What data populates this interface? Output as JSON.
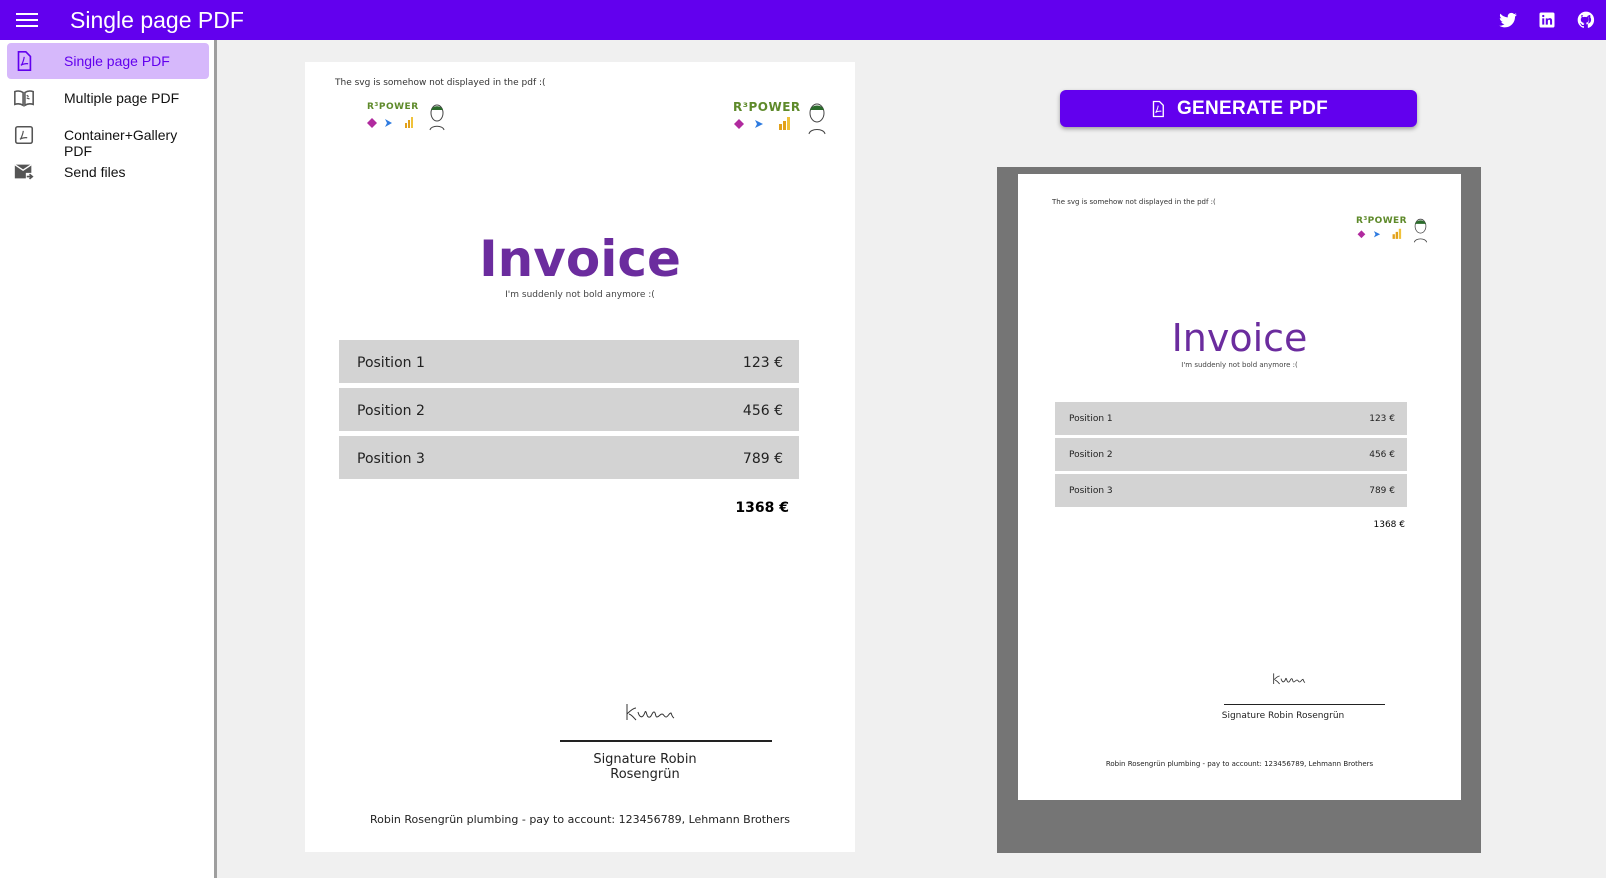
{
  "app": {
    "title": "Single page PDF"
  },
  "appbar_icons": [
    "twitter-icon",
    "linkedin-icon",
    "github-icon"
  ],
  "nav": {
    "items": [
      {
        "label": "Single page PDF",
        "icon": "pdf-file-icon",
        "active": true
      },
      {
        "label": "Multiple page PDF",
        "icon": "open-book-icon",
        "active": false
      },
      {
        "label": "Container+Gallery PDF",
        "icon": "pdf-box-icon",
        "active": false
      },
      {
        "label": "Send files",
        "icon": "email-send-icon",
        "active": false
      }
    ]
  },
  "colors": {
    "primary": "#6200ee",
    "nav_active_bg": "#d6b8fb",
    "invoice_title": "#6b2c9e",
    "row_bg": "#d3d3d3",
    "viewer_bg": "#757575"
  },
  "invoice": {
    "note": "The svg is somehow not displayed in the pdf :(",
    "logo_text": "R³POWER",
    "title": "Invoice",
    "subtitle": "I'm suddenly not bold anymore :(",
    "rows": [
      {
        "label": "Position 1",
        "amount": "123 €"
      },
      {
        "label": "Position 2",
        "amount": "456 €"
      },
      {
        "label": "Position 3",
        "amount": "789 €"
      }
    ],
    "total": "1368 €",
    "signature": "Signature Robin Rosengrün",
    "footer": "Robin Rosengrün plumbing - pay to account: 123456789, Lehmann Brothers"
  },
  "generate_button": {
    "label": "GENERATE PDF",
    "icon": "pdf-file-icon"
  }
}
